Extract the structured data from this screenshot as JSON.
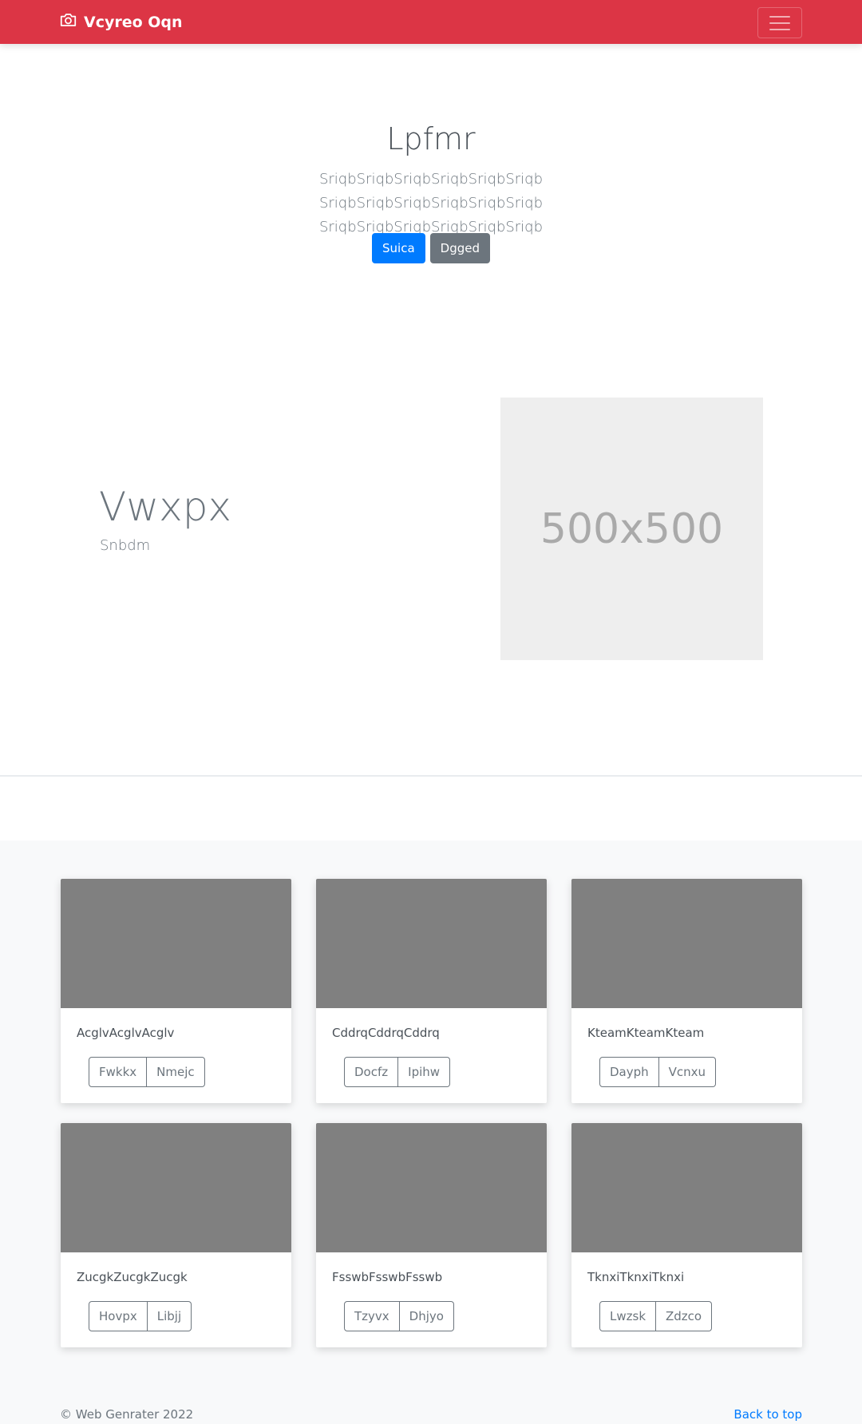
{
  "navbar": {
    "brand": "Vcyreo Oqn",
    "brand_icon": "camera-icon",
    "menu_icon": "hamburger-menu-icon",
    "background": "#dc3545"
  },
  "hero": {
    "title": "Lpfmr",
    "lead": "SriqbSriqbSriqbSriqbSriqbSriqb SriqbSriqbSriqbSriqbSriqbSriqb SriqbSriqbSriqbSriqbSriqbSriqb",
    "primary_button": "Suica",
    "secondary_button": "Dgged"
  },
  "feature": {
    "heading": "Vwxpx",
    "subheading": "Snbdm",
    "image_placeholder": "500x500"
  },
  "album": {
    "cards": [
      {
        "text": "AcglvAcglvAcglv",
        "buttons": [
          "Fwkkx",
          "Nmejc"
        ]
      },
      {
        "text": "CddrqCddrqCddrq",
        "buttons": [
          "Docfz",
          "Ipihw"
        ]
      },
      {
        "text": "KteamKteamKteam",
        "buttons": [
          "Dayph",
          "Vcnxu"
        ]
      },
      {
        "text": "ZucgkZucgkZucgk",
        "buttons": [
          "Hovpx",
          "Libjj"
        ]
      },
      {
        "text": "FsswbFsswbFsswb",
        "buttons": [
          "Tzyvx",
          "Dhjyo"
        ]
      },
      {
        "text": "TknxiTknxiTknxi",
        "buttons": [
          "Lwzsk",
          "Zdzco"
        ]
      }
    ]
  },
  "footer": {
    "copyright": "© Web Genrater 2022",
    "back_to_top": "Back to top"
  }
}
